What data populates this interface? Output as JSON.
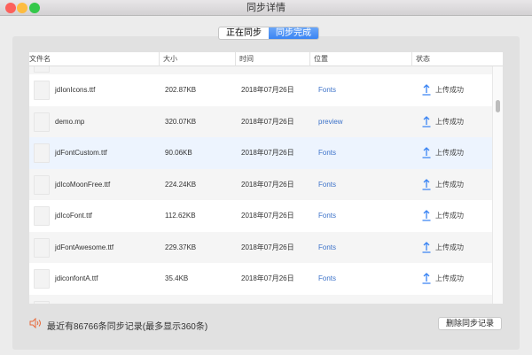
{
  "window": {
    "title": "同步详情"
  },
  "tabs": [
    {
      "label": "正在同步",
      "active": false
    },
    {
      "label": "同步完成",
      "active": true
    }
  ],
  "table": {
    "headers": [
      "文件名",
      "大小",
      "时间",
      "位置",
      "状态"
    ],
    "rows": [
      {
        "name": "",
        "size": "",
        "time": "",
        "location": "",
        "status": ""
      },
      {
        "name": "jdIonIcons.ttf",
        "size": "202.87KB",
        "time": "2018年07月26日",
        "location": "Fonts",
        "status": "上传成功"
      },
      {
        "name": "demo.mp",
        "size": "320.07KB",
        "time": "2018年07月26日",
        "location": "preview",
        "status": "上传成功"
      },
      {
        "name": "jdFontCustom.ttf",
        "size": "90.06KB",
        "time": "2018年07月26日",
        "location": "Fonts",
        "status": "上传成功"
      },
      {
        "name": "jdIcoMoonFree.ttf",
        "size": "224.24KB",
        "time": "2018年07月26日",
        "location": "Fonts",
        "status": "上传成功"
      },
      {
        "name": "jdIcoFont.ttf",
        "size": "112.62KB",
        "time": "2018年07月26日",
        "location": "Fonts",
        "status": "上传成功"
      },
      {
        "name": "jdFontAwesome.ttf",
        "size": "229.37KB",
        "time": "2018年07月26日",
        "location": "Fonts",
        "status": "上传成功"
      },
      {
        "name": "jdiconfontA.ttf",
        "size": "35.4KB",
        "time": "2018年07月26日",
        "location": "Fonts",
        "status": "上传成功"
      }
    ]
  },
  "footer": {
    "summary": "最近有86766条同步记录(最多显示360条)",
    "delete_label": "删除同步记录"
  },
  "colors": {
    "accent": "#3a84f3",
    "link": "#3c72c9",
    "selected_row": "#edf4fe",
    "speaker": "#e8693a"
  }
}
